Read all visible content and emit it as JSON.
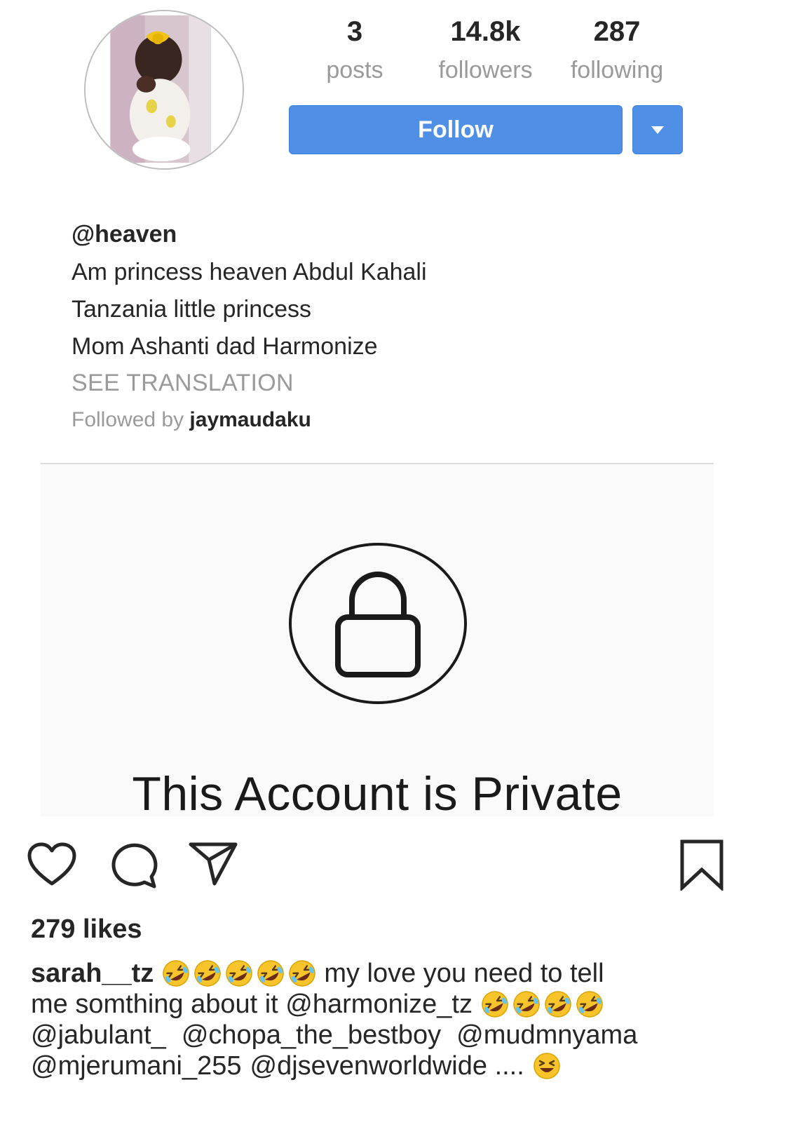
{
  "profile": {
    "username": "@heaven",
    "stats": [
      {
        "value": "3",
        "label": "posts"
      },
      {
        "value": "14.8k",
        "label": "followers"
      },
      {
        "value": "287",
        "label": "following"
      }
    ],
    "follow_label": "Follow",
    "bio_lines": [
      "Am princess heaven Abdul Kahali",
      "Tanzania little princess",
      "Mom Ashanti dad Harmonize"
    ],
    "see_translation": "SEE TRANSLATION",
    "followed_by_prefix": "Followed by",
    "followed_by_user": "jaymaudaku"
  },
  "private_notice": "This Account is Private",
  "post": {
    "likes": "279 likes",
    "caption": {
      "user": "sarah__tz",
      "line1_text": "my love you need to tell",
      "line2_text": "me somthing about it @harmonize_tz",
      "line3": [
        "@jabulant_",
        "@chopa_the_bestboy",
        "@mudmnyama"
      ],
      "line4_a": "@mjerumani_255",
      "line4_b": "@djsevenworldwide ....",
      "emoji_laughing": "rolling-on-floor-laughing-emoji",
      "emoji_grin": "grinning-squinting-face-emoji"
    }
  },
  "colors": {
    "follow_blue": "#4f90e6",
    "muted_text": "#9a9a9a",
    "private_panel_bg": "#fafafa"
  }
}
